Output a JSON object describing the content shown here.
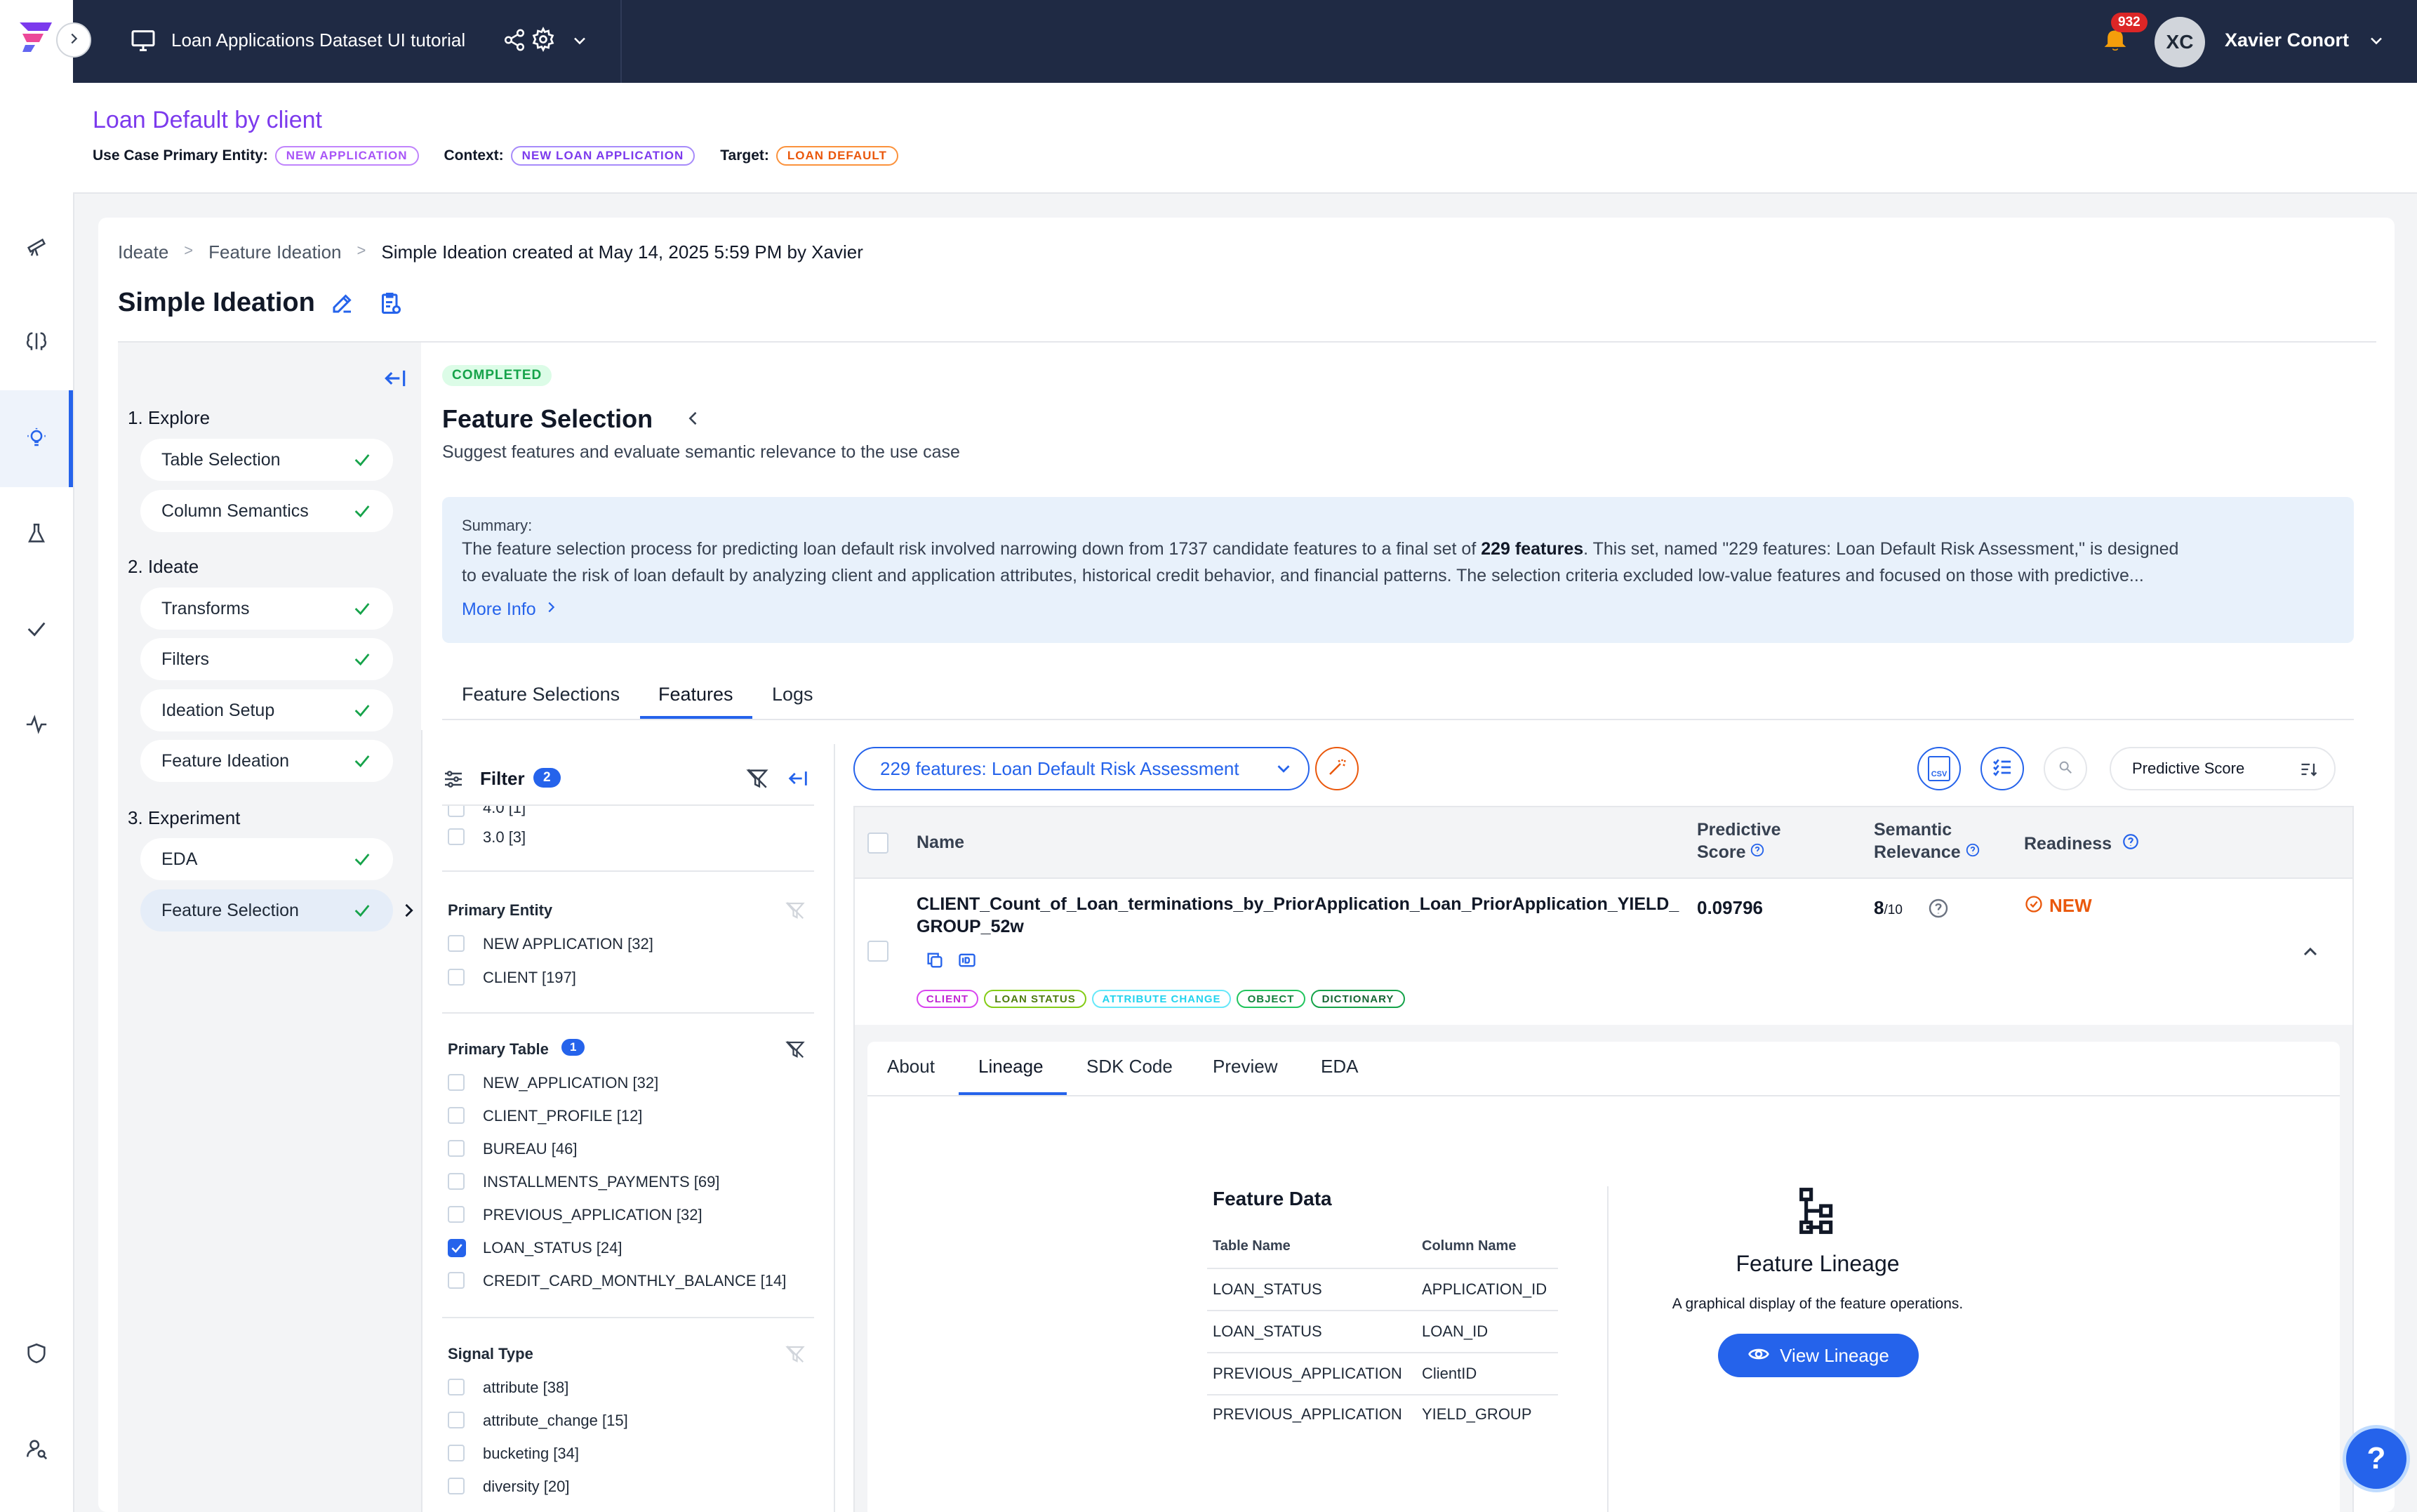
{
  "topbar": {
    "project_title": "Loan Applications Dataset UI tutorial",
    "notification_count": "932",
    "user_initials": "XC",
    "user_name": "Xavier Conort"
  },
  "use_case": {
    "title": "Loan Default by client",
    "primary_entity_label": "Use Case Primary Entity:",
    "primary_entity": "NEW APPLICATION",
    "context_label": "Context:",
    "context": "NEW LOAN APPLICATION",
    "target_label": "Target:",
    "target": "LOAN DEFAULT"
  },
  "breadcrumb": {
    "items": [
      "Ideate",
      "Feature Ideation",
      "Simple Ideation created at May 14, 2025 5:59 PM by Xavier"
    ],
    "separator": ">"
  },
  "page_title": "Simple Ideation",
  "steps": {
    "explore": "1. Explore",
    "ideate": "2. Ideate",
    "experiment": "3. Experiment",
    "items": [
      "Table Selection",
      "Column Semantics",
      "Transforms",
      "Filters",
      "Ideation Setup",
      "Feature Ideation",
      "EDA",
      "Feature Selection"
    ]
  },
  "panel": {
    "status": "COMPLETED",
    "title": "Feature Selection",
    "subtitle": "Suggest features and evaluate semantic relevance to the use case",
    "summary_label": "Summary:",
    "summary_line1_a": "The feature selection process for predicting loan default risk involved narrowing down from 1737 candidate features to a final set of ",
    "summary_line1_bold": "229 features",
    "summary_line1_b": ". This set, named \"229 features: Loan Default Risk Assessment,\" is designed",
    "summary_line2": "to evaluate the risk of loan default by analyzing client and application attributes, historical credit behavior, and financial patterns. The selection criteria excluded low-value features and focused on those with predictive...",
    "more_info": "More Info"
  },
  "tabs": [
    "Feature Selections",
    "Features",
    "Logs"
  ],
  "filter": {
    "title": "Filter",
    "count": "2",
    "truncated_item": "4.0 [1]",
    "item_3": "3.0 [3]",
    "primary_entity": {
      "label": "Primary Entity",
      "options": [
        "NEW APPLICATION [32]",
        "CLIENT [197]"
      ]
    },
    "primary_table": {
      "label": "Primary Table",
      "count": "1",
      "options": [
        "NEW_APPLICATION [32]",
        "CLIENT_PROFILE [12]",
        "BUREAU [46]",
        "INSTALLMENTS_PAYMENTS [69]",
        "PREVIOUS_APPLICATION [32]",
        "LOAN_STATUS [24]",
        "CREDIT_CARD_MONTHLY_BALANCE [14]"
      ]
    },
    "signal_type": {
      "label": "Signal Type",
      "options": [
        "attribute [38]",
        "attribute_change [15]",
        "bucketing [34]",
        "diversity [20]"
      ]
    }
  },
  "toolbar": {
    "selection": "229 features: Loan Default Risk Assessment",
    "sort": "Predictive Score",
    "csv_label": "CSV"
  },
  "table": {
    "headers": {
      "name": "Name",
      "predictive_1": "Predictive",
      "predictive_2": "Score",
      "semantic_1": "Semantic",
      "semantic_2": "Relevance",
      "readiness": "Readiness"
    },
    "row": {
      "name_line1": "CLIENT_Count_of_Loan_terminations_by_PriorApplication_Loan_PriorApplication_YIELD_",
      "name_line2": "GROUP_52w",
      "predictive_score": "0.09796",
      "semantic_value": "8",
      "semantic_scale": "/10",
      "readiness": "NEW",
      "tags": [
        "CLIENT",
        "LOAN STATUS",
        "ATTRIBUTE CHANGE",
        "OBJECT",
        "DICTIONARY"
      ]
    }
  },
  "detail_tabs": [
    "About",
    "Lineage",
    "SDK Code",
    "Preview",
    "EDA"
  ],
  "feature_data": {
    "title": "Feature Data",
    "col_table": "Table Name",
    "col_column": "Column Name",
    "rows": [
      {
        "table": "LOAN_STATUS",
        "column": "APPLICATION_ID"
      },
      {
        "table": "LOAN_STATUS",
        "column": "LOAN_ID"
      },
      {
        "table": "PREVIOUS_APPLICATION",
        "column": "ClientID"
      },
      {
        "table": "PREVIOUS_APPLICATION",
        "column": "YIELD_GROUP"
      }
    ]
  },
  "lineage": {
    "title": "Feature Lineage",
    "description": "A graphical display of the feature operations.",
    "button": "View Lineage"
  },
  "help_label": "?",
  "colors": {
    "topbar_bg": "#1f2a44",
    "accent": "#2563eb",
    "brand_purple": "#7c3aed",
    "success": "#16a34a",
    "orange": "#ea580c"
  },
  "icons": [
    "logo-icon",
    "expand-icon",
    "monitor-icon",
    "share-icon",
    "gear-icon",
    "chevron-down-icon",
    "bell-icon",
    "telescope-icon",
    "brain-icon",
    "lightbulb-icon",
    "flask-icon",
    "check-icon",
    "pulse-icon",
    "shield-icon",
    "user-search-icon",
    "edit-icon",
    "clipboard-icon",
    "collapse-icon",
    "filter-icon",
    "filter-clear-icon",
    "wand-icon",
    "csv-icon",
    "list-check-icon",
    "search-icon",
    "sort-icon",
    "copy-icon",
    "id-icon",
    "help-circle-icon",
    "new-check-icon",
    "chevron-up-icon",
    "hierarchy-icon",
    "eye-icon"
  ]
}
